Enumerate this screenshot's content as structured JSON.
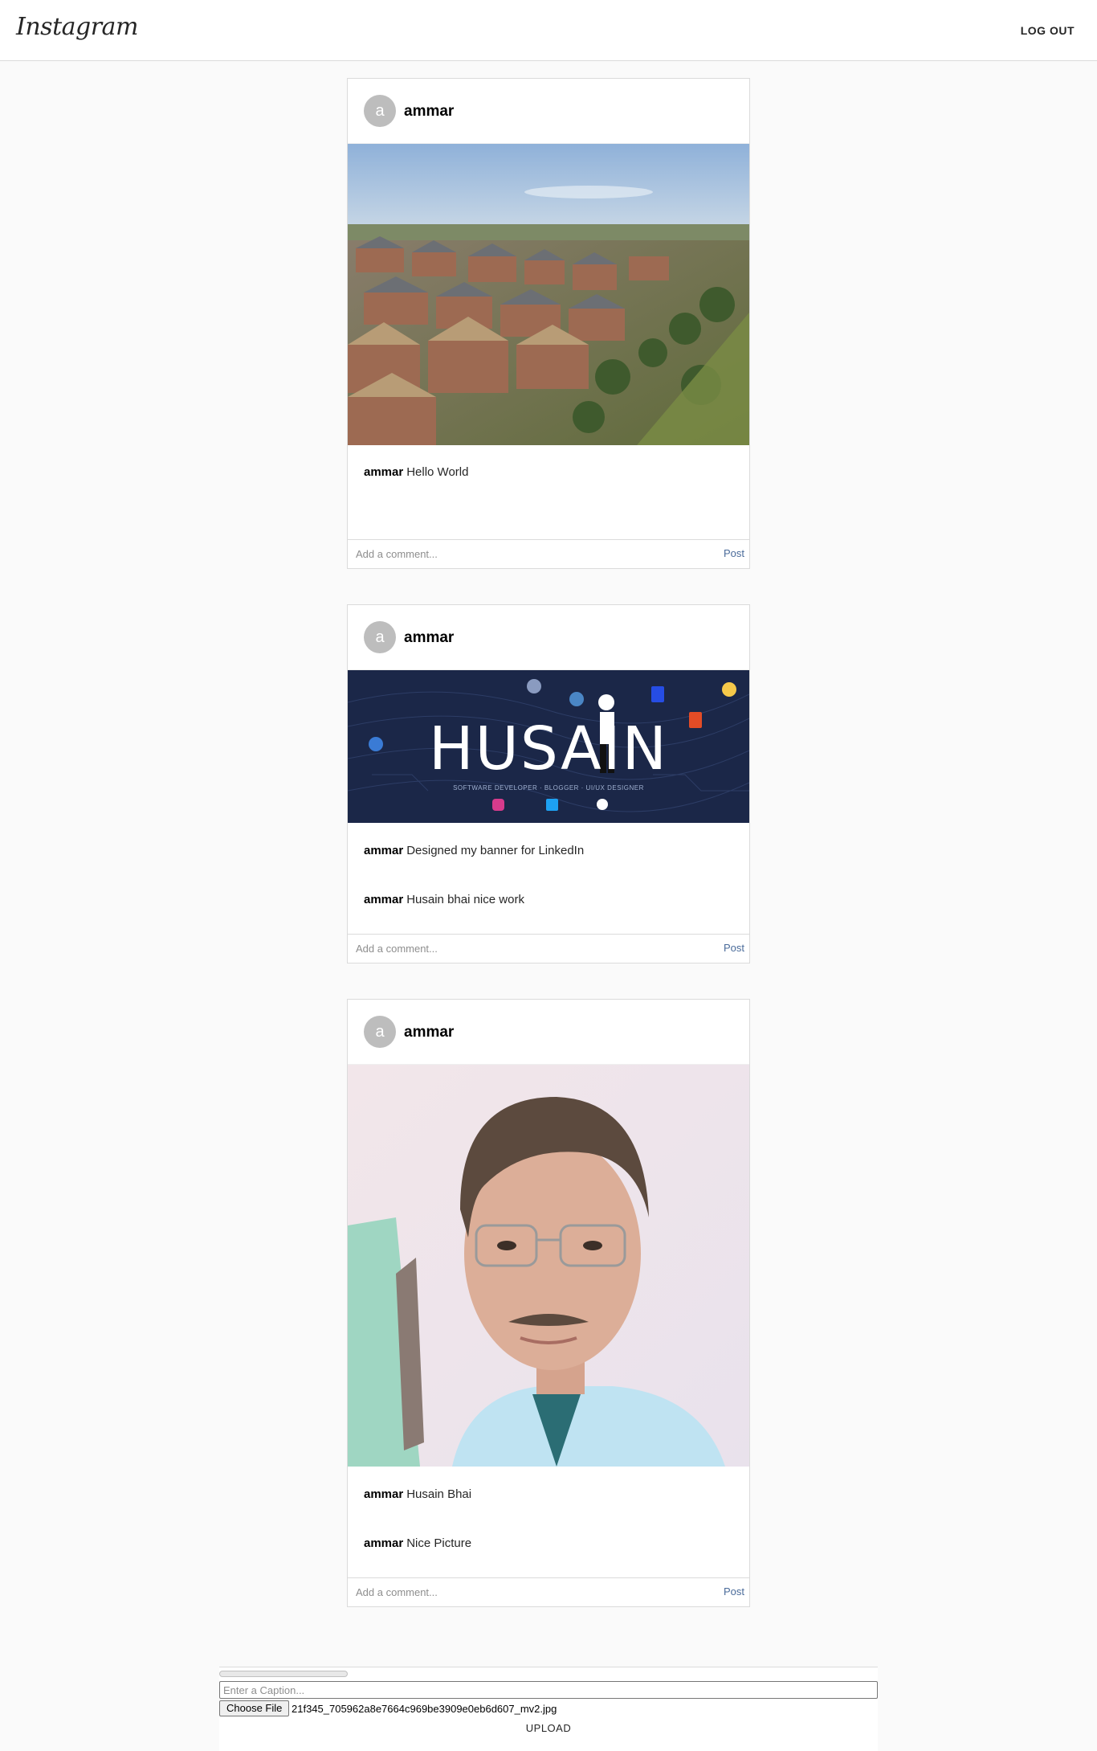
{
  "header": {
    "logo": "Instagram",
    "logout_label": "LOG OUT"
  },
  "posts": [
    {
      "avatar_letter": "a",
      "username": "ammar",
      "image": "aerial-suburb-houses-photo",
      "comments": [
        {
          "user": "ammar",
          "text": "Hello World"
        }
      ],
      "comment_placeholder": "Add a comment...",
      "post_label": "Post"
    },
    {
      "avatar_letter": "a",
      "username": "ammar",
      "image": "husain-linkedin-banner",
      "banner": {
        "title": "HUSAIN",
        "subtitle": "SOFTWARE DEVELOPER · BLOGGER · UI/UX DESIGNER"
      },
      "comments": [
        {
          "user": "ammar",
          "text": "Designed my banner for LinkedIn"
        },
        {
          "user": "ammar",
          "text": "Husain bhai nice work"
        }
      ],
      "comment_placeholder": "Add a comment...",
      "post_label": "Post"
    },
    {
      "avatar_letter": "a",
      "username": "ammar",
      "image": "portrait-photo",
      "comments": [
        {
          "user": "ammar",
          "text": "Husain Bhai"
        },
        {
          "user": "ammar",
          "text": "Nice Picture"
        }
      ],
      "comment_placeholder": "Add a comment...",
      "post_label": "Post"
    }
  ],
  "upload": {
    "progress": 0,
    "caption_placeholder": "Enter a Caption...",
    "choose_file_label": "Choose File",
    "file_name": "21f345_705962a8e7664c969be3909e0eb6d607_mv2.jpg",
    "upload_label": "UPLOAD"
  },
  "colors": {
    "link": "#4a6b9a",
    "border": "#dbdbdb",
    "background": "#fafafa"
  }
}
